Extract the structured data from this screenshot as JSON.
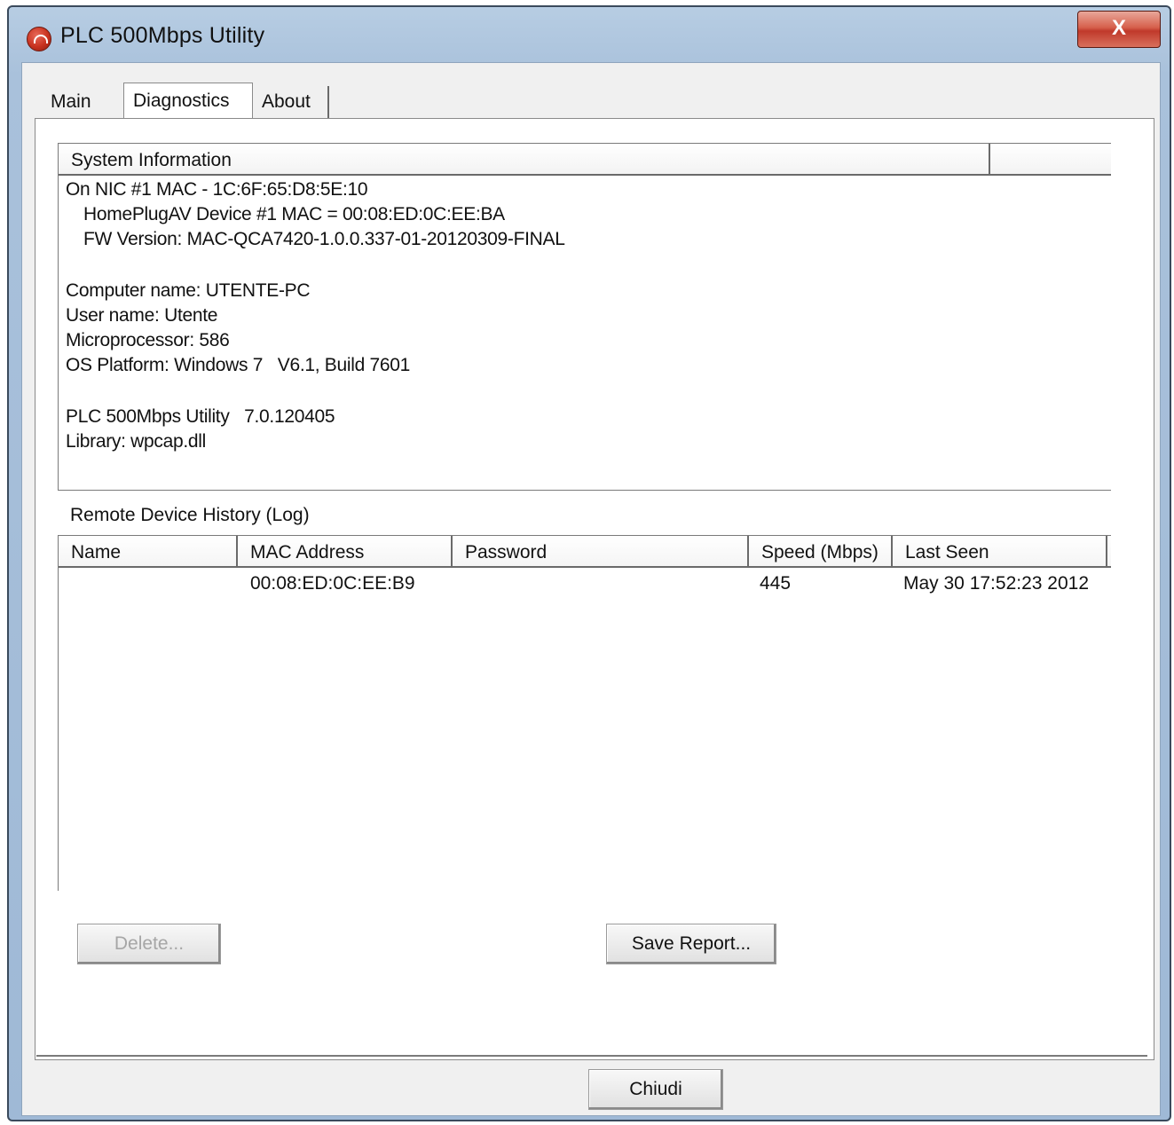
{
  "window": {
    "title": "PLC 500Mbps Utility",
    "close_glyph": "X",
    "close_color": "#c0392b"
  },
  "tabs": [
    {
      "label": "Main"
    },
    {
      "label": "Diagnostics"
    },
    {
      "label": "About"
    }
  ],
  "selected_tab": "Diagnostics",
  "system_info": {
    "header": "System Information",
    "lines": [
      "On NIC #1 MAC - 1C:6F:65:D8:5E:10",
      "HomePlugAV Device #1 MAC = 00:08:ED:0C:EE:BA",
      "FW Version: MAC-QCA7420-1.0.0.337-01-20120309-FINAL",
      "Computer name: UTENTE-PC",
      "User name: Utente",
      "Microprocessor: 586",
      "OS Platform: Windows 7   V6.1, Build 7601",
      "PLC 500Mbps Utility   7.0.120405",
      "Library: wpcap.dll"
    ]
  },
  "remote_history": {
    "label": "Remote Device History (Log)",
    "columns": [
      "Name",
      "MAC Address",
      "Password",
      "Speed (Mbps)",
      "Last Seen"
    ],
    "rows": [
      {
        "name": "",
        "mac": "00:08:ED:0C:EE:B9",
        "password": "",
        "speed": "445",
        "last_seen": "May 30 17:52:23 2012"
      }
    ]
  },
  "buttons": {
    "delete": "Delete...",
    "save_report": "Save Report...",
    "close": "Chiudi"
  }
}
